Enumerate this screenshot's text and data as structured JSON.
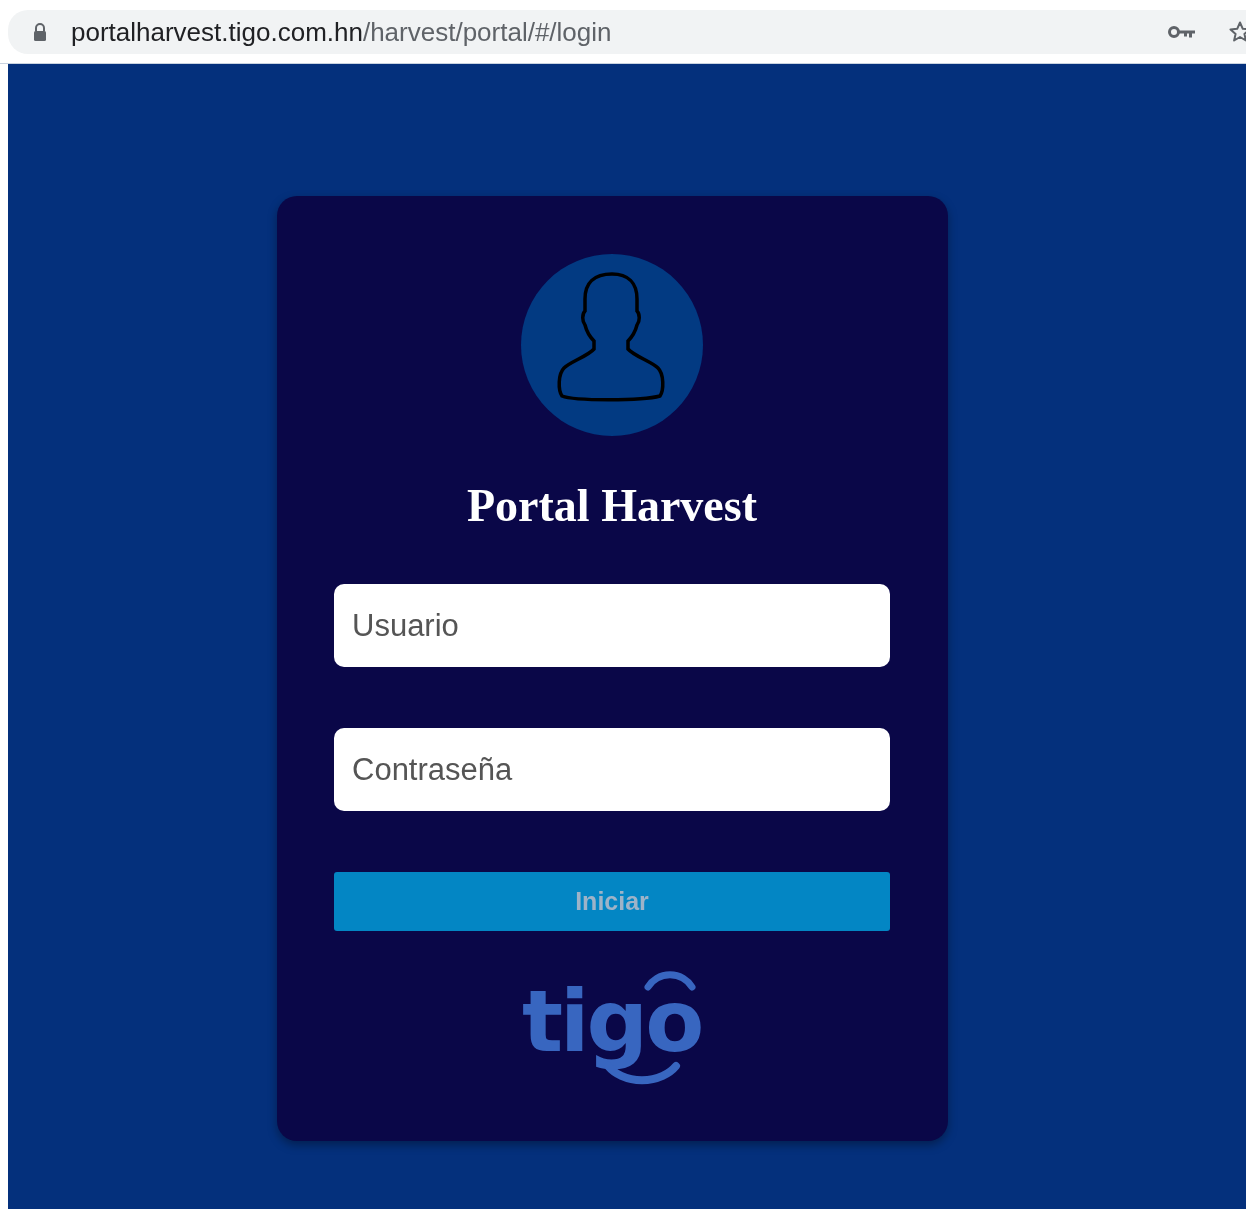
{
  "address_bar": {
    "host": "portalharvest.tigo.com.hn",
    "path": "/harvest/portal/#/login"
  },
  "login": {
    "title": "Portal Harvest",
    "fields": [
      {
        "placeholder": "Usuario"
      },
      {
        "placeholder": "Contraseña"
      }
    ],
    "submit": {
      "label": "Iniciar"
    },
    "logo": {
      "text": "tigo"
    }
  }
}
